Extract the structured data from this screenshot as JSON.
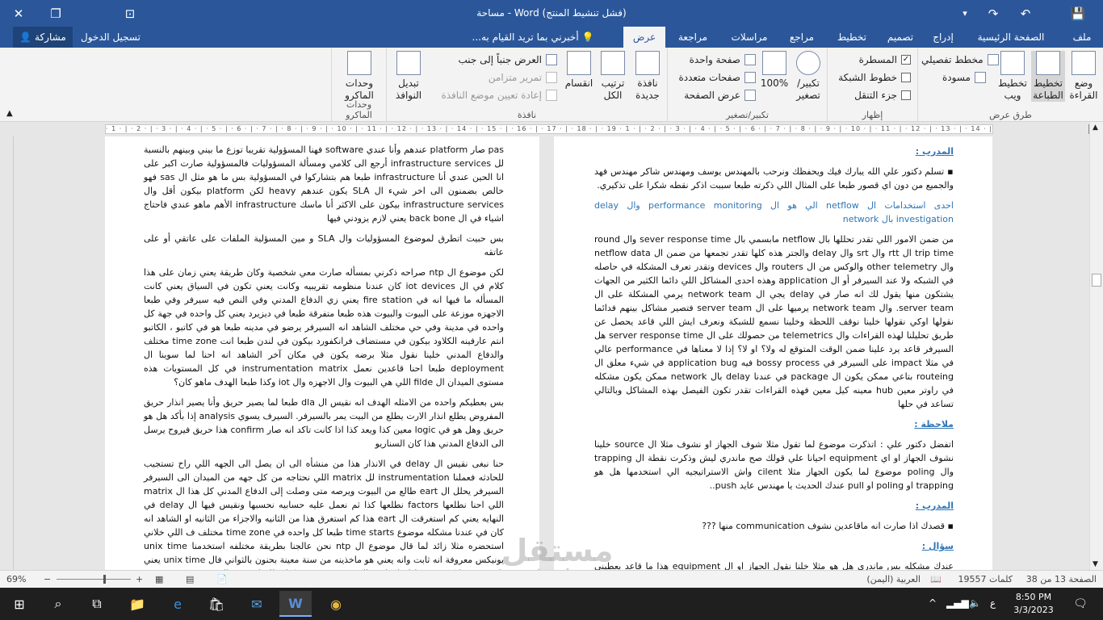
{
  "window": {
    "title": "مساحة - Word (فشل تنشيط المنتج)"
  },
  "tabs": {
    "file": "ملف",
    "home": "الصفحة الرئيسية",
    "insert": "إدراج",
    "design": "تصميم",
    "layout": "تخطيط",
    "references": "مراجع",
    "mailings": "مراسلات",
    "review": "مراجعة",
    "view": "عرض",
    "tellme": "أخبرني بما تريد القيام به...",
    "signin": "تسجيل الدخول",
    "share": "مشاركة"
  },
  "ribbon": {
    "views": {
      "group": "طرق عرض",
      "read_mode": "وضع القراءة",
      "print_layout": "تخطيط الطباعة",
      "web_layout": "تخطيط ويب",
      "outline": "مخطط تفصيلي",
      "draft": "مسودة"
    },
    "show": {
      "group": "إظهار",
      "ruler": "المسطرة",
      "gridlines": "خطوط الشبكة",
      "nav_pane": "جزء التنقل"
    },
    "zoom": {
      "group": "تكبير/تصغير",
      "zoom": "تكبير/ تصغير",
      "hundred": "100%",
      "one_page": "صفحة واحدة",
      "multi_pages": "صفحات متعددة",
      "page_width": "عرض الصفحة"
    },
    "window": {
      "group": "نافذة",
      "new_window": "نافذة جديدة",
      "arrange_all": "ترتيب الكل",
      "split": "انقسام",
      "side_by_side": "العرض جنباً إلى جنب",
      "sync_scroll": "تمرير متزامن",
      "reset_position": "إعادة تعيين موضع النافذة",
      "switch_windows": "تبديل النوافذ"
    },
    "macros": {
      "group": "وحدات الماكرو",
      "macros": "وحدات الماكرو"
    }
  },
  "ruler_text": "· 1 · | · 2 · | · 3 · | · 4 · | · 5 · | · 6 · | · 7 · | · 8 · | · 9 · | · 10 · | · 11 · | · 12 · | · 13 · | · 14 · | · 15 · | · 16 · | · 17 · | · 18 · | · 19   · 1 · | · 2 · | · 3 · | · 4 · | · 5 · | · 6 · | · 7 · | · 8 · | · 9 · | · 10 · | · 11 · | · 12 · | · 13 · | · 14 · | · 15 · | · 16 · | · 17 · | · 18 · | · 19",
  "page_left": {
    "p1": "pas صار platform عندهم وأنا عندي software فهنا المسؤولية تقريبا توزع ما بيني وبينهم بالنسبة لل infrastructure services أرجع الى كلامي ومسألة المسؤوليات فالمسؤولية صارت اكبر على انا الحين عندي أنا infrastructure طبعا هم بتشاركوا في المسؤولية بس ما هو مثل ال sas فهو خالص بضمنون الى اخر شيء ال SLA يكون عندهم heavy لكن platform بيكون أقل وال infrastructure services بيكون على الاكثر أنا ماسك infrastructure الأهم ماهو عندي فاحتاج اشياء في ال back bone يعني لازم يزودني فيها",
    "p2": "بس حبيت اتطرق لموضوع المسؤوليات وال SLA و مين المسؤلية الملفات على عاتقي أو على عاتقه",
    "p3": "لكن موضوع ال ntp صراحه ذكرني بمسأله صارت معي شخصية وكان طريقة يعني زمان على هذا كلام في ال iot devices كان عندنا منظومه تقريبيه وكانت يعني تكون في السياق يعني كانت المسأله ما فيها انه في fire station يعني زي الدفاع المدني وفي النص فيه سيرفر وفي طبعا الاجهزه موزعة على البيوت والبيوت هذه طبعا متفرقة طبعا في ديزيرد يعني كل واحده في جهة كل واحده في مدينة وفي حي مختلف الشاهد انه السيرفر يرضو في مدينه طبعا هو في كاتبو ، الكاتبو انتم عارفينه الكلاود بيكون في مستضاف فرانكفورد بيكون في لندن طبعا انت time zone مختلف والدفاع المدني خلينا نقول مثلا برضه يكون في مكان آخر الشاهد انه احنا لما سوينا ال deployment طبعا احنا قاعدين نعمل instrumentation matrix في كل المستويات هذه مستوى الميدان ال filde اللي هي البيوت وال الاجهزه وال iot وكذا طبعا الهدف ماهو كان؟",
    "p4": "بس بعطيكم واحده من الامثله الهدف انه نقيس ال dla طبعا لما يصير حريق وأنا يصير انذار حريق المفروض يطلع انذار الارت يطلع من البيت يمر بالسيرفر. السيرف يسوي analysis إذا بأكد هل هو حريق وهل هو في logic معين كذا ويعد كذا اذا كانت تاكد انه صار confirm هذا حريق فيروح يرسل الى الدفاع المدني هذا كان السناريو",
    "p5": "حنا نبغى نقيس ال delay في الانذار هذا من منشأه الى ان يصل الى الجهه اللي راح تستجيب للحادثه فعملنا instrumentation لل matrix اللي نحتاجه من كل جهه من الميدان الى السيرفر السيرفر يحلل ال eart طالع من البيوت ويرصه متى وصلت إلى الدفاع المدني كل هذا ال matrix اللي احنا نطلعها factors نطلعها كذا ثم نعمل عليه حسابيه نحسبها ونقيس فيها ال delay في النهايه يعني كم استغرقت ال eart هذا كم استغرق هذا من الثانيه والاجزاء من الثانيه او الشاهد انه كان في عندنا مشكله موضوع time starts طبعا كل واحده في time zone مختلف ف اللي خلاني استحضره مثلا زائد لما قال موضوع ال ntp نحن عالجنا بطريقة مختلفه استخدمنا unix time يونيكس معروفة انه ثابت وانه يعني هو ماخذينه من سنة معينة بحنون بالثواني فال unix time يعني ثابت وين مايكون قصرنا احنا خلاص ال time stamps كنا نطلعها حسب ال time stamps في نفس السيرفر ببساطه يعني دايبف خلينا نقول كذا ناخذ بس ال time stamps من كل مثلا من السيرف ومن البيوت من الدفاع المدني كان هذا يعني يسبب خطأ في الحسابات فشفنا الخطأ وشفنا يعني قيش"
  },
  "page_right": {
    "speaker1": "المدرب :",
    "b1": "تسلم دكتور علي الله يبارك فيك ويحفظك ونرحب بالمهندس يوسف ومهندس شاكر مهندس فهد والجميع من دون اي قصور طبعا على المثال اللي ذكرته طبعا سببت اذكر نقطه شكرا على تذكيري.",
    "heading1": "احدى استخدامات ال netflow الي هو ال performance monitoring وال delay investigation بال network",
    "p1": "من ضمن الامور اللي تقدر تحللها بال netflow مابسمي بال sever response time وال round trip time ال rtt وال srt وال delay والجتر هذه كلها تقدر تجمعها من ضمن ال netflow data وال other telemetry والوكس من ال routers وال devices وتقدر تعرف المشكله في حاصله في الشبكه ولا عند السيرفر أو ال application وهذه احدى المشاكل اللي دائما الكثير من الجهات يشتكون منها يقول لك انه صار في delay يجي ال network team يرمي المشكلة على ال server team. وال network team يرميها على ال server team فتصير مشاكل بينهم فدائما نقولها اوكي نقولها خلينا نوقف اللحظة وخلينا نسمع للشبكة ونعرف ايش اللي قاعد يحصل عن طريق تحليلنا لهذه القراءات وال telemetrics من حصولك على ال server response time هل السيرفر قاعد يرد علينا ضمن الوقت المتوقع له ولا؟ او لا؟ إذا لا معناها في performance عالي في مثلا impact على السيرفر في bossy process فيه application bug في شيء معلق ال routeing بتاعي ممكن يكون ال package في عندنا delay بال network ممكن يكون مشكله في راوتر معين hub معينه كيل معين فهذه القراءات تقدر تكون الفيصل بهذه المشاكل وبالتالي تساعد في حلها",
    "speaker2": "ملاحظة :",
    "p2": "اتفضل دكتور علي : اتذكرت موضوع لما تقول مثلا شوف الجهاز او نشوف مثلا ال source خلينا نشوف الجهاز او اي equipment احيانا علي قولك صح ماندري ليش وذكرت نقطة ال trapping وال poling موضوع لما يكون الجهاز مثلا cilent واش الاستراتيجيه الي استخدمها هل هو trapping او poling او pull عندك الحديث يا مهندس عايد push..",
    "speaker3": "المدرب :",
    "b2": "قصدك اذا صارت انه ماقاعدين نشوف communication منها ???",
    "speaker4": "سؤال :",
    "p3": "عندك مشكله بس ماندري هل هو مثلا خلنا نقول الجهاز او ال equipment هذا ما قاعد يعطيني انذارات لكن انا ما قاعد يعطيني انذارات ماني عارف هل كل شيء تمام ولا هو صاير silent؟"
  },
  "status": {
    "page": "الصفحة 13 من 38",
    "words": "19557 كلمات",
    "language": "العربية (اليمن)",
    "zoom": "69%"
  },
  "taskbar": {
    "time": "8:50 PM",
    "date": "3/3/2023",
    "lang": "ع"
  },
  "watermark": {
    "main": "مستقل",
    "sub": "mostaql.com"
  }
}
